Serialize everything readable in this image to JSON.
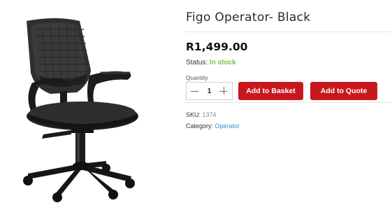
{
  "product": {
    "title": "Figo Operator- Black",
    "price": "R1,499.00",
    "status_label": "Status:",
    "status_value": "In stock",
    "image_name": "black-mesh-office-chair"
  },
  "quantity": {
    "label": "Quantity",
    "value": "1"
  },
  "actions": {
    "add_to_basket": "Add to Basket",
    "add_to_quote": "Add to Quote"
  },
  "meta": {
    "sku_label": "SKU:",
    "sku_value": "1374",
    "category_label": "Category:",
    "category_value": "Operator"
  },
  "colors": {
    "accent_red": "#c9171e",
    "in_stock_green": "#7ac142",
    "link_blue": "#3a8fc9"
  }
}
